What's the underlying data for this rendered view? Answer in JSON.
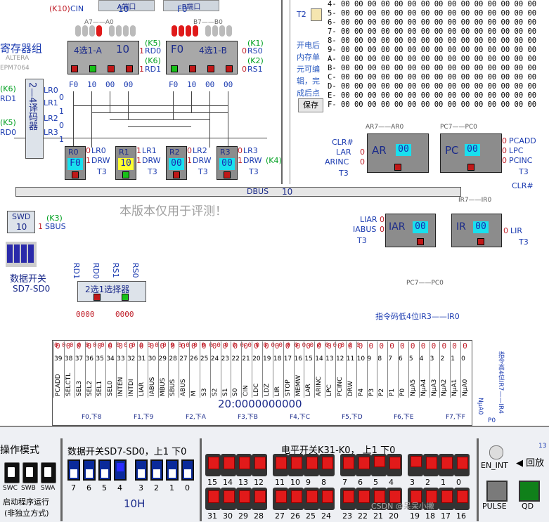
{
  "regfile": {
    "title": "寄存器组",
    "chip": "ALTERA",
    "chip_model": "EPM7064",
    "decoder": "2—4译码器",
    "decoder_outputs": [
      "LR0",
      "LR1",
      "LR2",
      "LR3"
    ],
    "decoder_bits": [
      "0",
      "1",
      "0",
      "1"
    ],
    "rd1_label": "RD1",
    "rd0_label": "RD0",
    "k6": "(K6)",
    "k5": "(K5)",
    "k10": "(K10)",
    "cin": "CIN",
    "a_bus_label": "A端口",
    "b_bus_label": "B端口",
    "a_bus_value": "10",
    "b_bus_value": "F0",
    "a_bits": "A7——A0",
    "b_bits": "B7——B0"
  },
  "mux_a": {
    "label": "4选1-A",
    "value": "10",
    "sel": [
      "RD0",
      "RD1"
    ],
    "sel_bits": [
      "1",
      "1"
    ],
    "k": [
      "(K5)",
      "(K6)"
    ],
    "inputs": [
      "F0",
      "10",
      "00",
      "00"
    ]
  },
  "mux_b": {
    "label": "4选1-B",
    "value": "F0",
    "sel": [
      "RS0",
      "RS1"
    ],
    "sel_bits": [
      "0",
      "0"
    ],
    "k": [
      "(K1)",
      "(K2)"
    ],
    "inputs": [
      "F0",
      "10",
      "00",
      "00"
    ]
  },
  "registers": [
    {
      "name": "R0",
      "value": "F0",
      "lr": "LR0",
      "lr_bit": "0",
      "drw_bit": "1",
      "t3": "T3"
    },
    {
      "name": "R1",
      "value": "10",
      "lr": "LR1",
      "lr_bit": "1",
      "drw_bit": "1",
      "t3": "T3"
    },
    {
      "name": "R2",
      "value": "00",
      "lr": "LR2",
      "lr_bit": "0",
      "drw_bit": "1",
      "t3": "T3"
    },
    {
      "name": "R3",
      "value": "00",
      "lr": "LR3",
      "lr_bit": "0",
      "drw_bit": "1",
      "t3": "T3"
    }
  ],
  "drw_label": "DRW",
  "k4": "(K4)",
  "dbus": {
    "label": "DBUS",
    "value": "10"
  },
  "watermark": "本版本仅用于评测！",
  "swd": {
    "label": "SWD",
    "value": "10",
    "sbus_bit": "1",
    "sbus": "SBUS",
    "k": "(K3)"
  },
  "data_switch": {
    "label": "数据开关",
    "range": "SD7-SD0"
  },
  "selector": {
    "label": "2选1选择器",
    "inputs": [
      "RD1",
      "RD0",
      "RS1",
      "RS0"
    ],
    "left_bits": "0000",
    "right_bits": "0000"
  },
  "memory": {
    "t2": "T2",
    "rows": [
      {
        "addr": "4-",
        "vals": "00 00 00 00 00 00 00 00 00 00 00 00 00 00 00"
      },
      {
        "addr": "5-",
        "vals": "00 00 00 00 00 00 00 00 00 00 00 00 00 00 00"
      },
      {
        "addr": "6-",
        "vals": "00 00 00 00 00 00 00 00 00 00 00 00 00 00 00"
      },
      {
        "addr": "7-",
        "vals": "00 00 00 00 00 00 00 00 00 00 00 00 00 00 00"
      },
      {
        "addr": "8-",
        "vals": "00 00 00 00 00 00 00 00 00 00 00 00 00 00 00"
      },
      {
        "addr": "9-",
        "vals": "00 00 00 00 00 00 00 00 00 00 00 00 00 00 00"
      },
      {
        "addr": "A-",
        "vals": "00 00 00 00 00 00 00 00 00 00 00 00 00 00 00"
      },
      {
        "addr": "B-",
        "vals": "00 00 00 00 00 00 00 00 00 00 00 00 00 00 00"
      },
      {
        "addr": "C-",
        "vals": "00 00 00 00 00 00 00 00 00 00 00 00 00 00 00"
      },
      {
        "addr": "D-",
        "vals": "00 00 00 00 00 00 00 00 00 00 00 00 00 00 00"
      },
      {
        "addr": "E-",
        "vals": "00 00 00 00 00 00 00 00 00 00 00 00 00 00 00"
      },
      {
        "addr": "F-",
        "vals": "00 00 00 00 00 00 00 00 00 00 00 00 00 00 00"
      }
    ],
    "hint_lines": [
      "开电后",
      "内存单",
      "元可编",
      "辑，完",
      "成后点"
    ],
    "save_button": "保存"
  },
  "ar": {
    "name": "AR",
    "value": "00",
    "bits": "AR7——AR0",
    "ctrl": [
      "CLR#",
      "LAR",
      "ARINC"
    ],
    "ctrl_bits": [
      "",
      "0",
      "0"
    ],
    "t3": "T3"
  },
  "pc": {
    "name": "PC",
    "value": "00",
    "bits": "PC7——PC0",
    "ctrl": [
      "PCADD",
      "LPC",
      "PCINC"
    ],
    "ctrl_bits": [
      "0",
      "0",
      "0"
    ],
    "t3": "T3",
    "clr": "CLR#"
  },
  "iar": {
    "name": "IAR",
    "value": "00",
    "ctrl": [
      "LIAR",
      "IABUS"
    ],
    "ctrl_bits": [
      "0",
      "0"
    ],
    "t3": "T3",
    "pc_label": "PC7——PC0"
  },
  "ir": {
    "name": "IR",
    "value": "00",
    "bits": "IR7——IR0",
    "ctrl": [
      "LIR"
    ],
    "ctrl_bits": [
      "0"
    ],
    "t3": "T3"
  },
  "ir_low_label": "指令码低4位IR3——IR0",
  "ir_high_label": "指令高4位IR7——IR4",
  "control_word": {
    "bits_top": [
      "0",
      "0",
      "0",
      "0",
      "0",
      "0",
      "0",
      "0",
      "0",
      "0",
      "0",
      "0",
      "0",
      "0",
      "0",
      "0",
      "0",
      "0",
      "0",
      "0",
      "0",
      "0",
      "0",
      "0",
      "0",
      "0",
      "0",
      "0",
      "0",
      "0",
      "0",
      "0",
      "0",
      "0",
      "0",
      "0",
      "0",
      "0",
      "0",
      "0"
    ],
    "numbers": [
      "39",
      "38",
      "37",
      "36",
      "35",
      "34",
      "33",
      "32",
      "31",
      "30",
      "29",
      "28",
      "27",
      "26",
      "25",
      "24",
      "23",
      "22",
      "21",
      "20",
      "19",
      "18",
      "17",
      "16",
      "15",
      "14",
      "13",
      "12",
      "11",
      "10",
      "9",
      "8",
      "7",
      "6",
      "5",
      "4",
      "3",
      "2",
      "1",
      "0"
    ],
    "signals": [
      "PCADD",
      "SELCTL",
      "SEL3",
      "SEL2",
      "SEL1",
      "SEL0",
      "INTEN",
      "INTDI",
      "LIAR",
      "IABUS",
      "MBUS",
      "SBUS",
      "ABUS",
      "M",
      "S3",
      "S2",
      "S1",
      "S0",
      "CIN",
      "LDC",
      "LDZ",
      "LIR",
      "STOP",
      "MEMW",
      "LAR",
      "ARINC",
      "LPC",
      "PCINC",
      "DRW",
      "P4",
      "P3",
      "P2",
      "P1",
      "P0",
      "NµA5",
      "NµA4",
      "NµA3",
      "NµA2",
      "NµA1",
      "NµA0"
    ],
    "address": "20:0000000000",
    "fgroups": [
      "F0,下8",
      "F1,下9",
      "F2,下A",
      "F3,下B",
      "F4,下C",
      "F5,下D",
      "F6,下E",
      "F7,下F"
    ],
    "nua": "NµA0",
    "p0": "P0"
  },
  "bottom": {
    "mode_title": "操作模式",
    "mode_switches": [
      "SWC",
      "SWB",
      "SWA"
    ],
    "mode_desc1": "启动程序运行",
    "mode_desc2": "(非独立方式)",
    "data_sw_title": "数据开关SD7-SD0，上1 下0",
    "data_sw_nums": [
      "7",
      "6",
      "5",
      "4",
      "3",
      "2",
      "1",
      "0"
    ],
    "data_sw_on": [
      false,
      false,
      false,
      true,
      false,
      false,
      false,
      false
    ],
    "data_value": "10H",
    "level_title": "电平开关K31-K0， 上1 下0",
    "row1_nums": [
      "15",
      "14",
      "13",
      "12",
      "11",
      "10",
      "9",
      "8",
      "7",
      "6",
      "5",
      "4",
      "3",
      "2",
      "1",
      "0"
    ],
    "row1_on": [
      false,
      false,
      false,
      false,
      false,
      false,
      false,
      false,
      false,
      false,
      true,
      false,
      true,
      false,
      false,
      false
    ],
    "row2_nums": [
      "31",
      "30",
      "29",
      "28",
      "27",
      "26",
      "25",
      "24",
      "23",
      "22",
      "21",
      "20",
      "19",
      "18",
      "17",
      "16"
    ],
    "en_int": "EN_INT",
    "rollback": "回放",
    "rollback_num": "13",
    "pulse": "PULSE",
    "qd": "QD",
    "credit": "CSDN @呆呆小撇"
  },
  "colors": {
    "bus": "#e6e6e6",
    "reg_value": "#19e0ee",
    "active_reg": "#ffff30",
    "panel": "#eef0f4"
  }
}
